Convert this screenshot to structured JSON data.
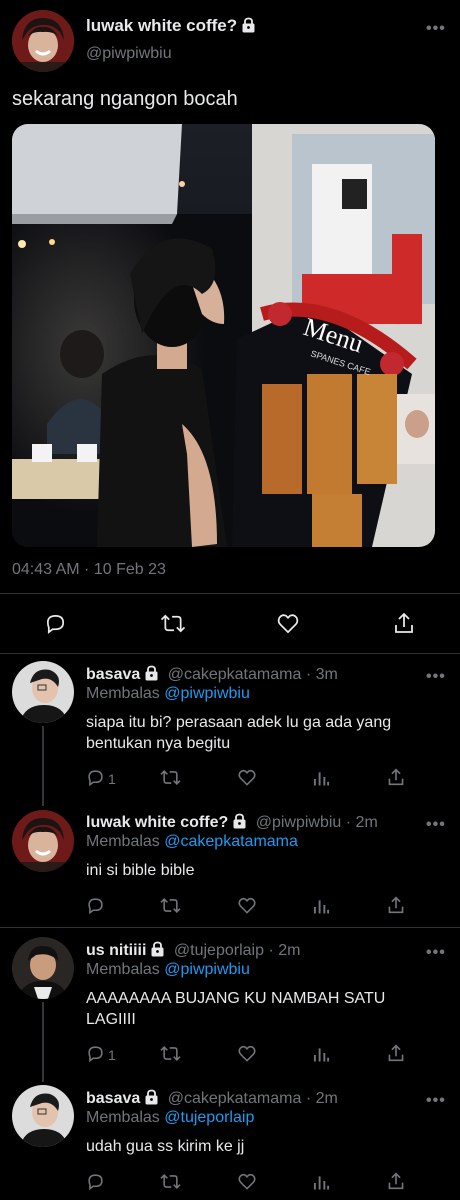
{
  "main_tweet": {
    "name": "luwak white coffe?",
    "handle": "@piwpiwbiu",
    "text": "sekarang ngangon bocah",
    "media_sign": "Menu",
    "media_subsign": "SPANES CAFE",
    "timestamp": "04:43 AM · 10 Feb 23"
  },
  "more_label": "•••",
  "replies": [
    {
      "name": "basava",
      "handle": "@cakepkatamama",
      "time": "· 3m",
      "replying_prefix": "Membalas",
      "replying_to": "@piwpiwbiu",
      "text": "siapa itu bi? perasaan adek lu ga ada yang bentukan nya begitu",
      "reply_count": "1"
    },
    {
      "name": "luwak white coffe?",
      "handle": "@piwpiwbiu",
      "time": "· 2m",
      "replying_prefix": "Membalas",
      "replying_to": "@cakepkatamama",
      "text": "ini si bible bible",
      "reply_count": ""
    },
    {
      "name": "us nitiiii",
      "handle": "@tujeporlaip",
      "time": "· 2m",
      "replying_prefix": "Membalas",
      "replying_to": "@piwpiwbiu",
      "text": "AAAAAAAA BUJANG KU NAMBAH SATU LAGIIII",
      "reply_count": "1"
    },
    {
      "name": "basava",
      "handle": "@cakepkatamama",
      "time": "· 2m",
      "replying_prefix": "Membalas",
      "replying_to": "@tujeporlaip",
      "text": "udah gua ss kirim ke jj",
      "reply_count": ""
    }
  ],
  "colors": {
    "background": "#000000",
    "text": "#e7e9ea",
    "muted": "#71767b",
    "link": "#1d9bf0",
    "divider": "#2f3336"
  },
  "icons": [
    "lock-icon",
    "more-icon",
    "reply-icon",
    "retweet-icon",
    "like-icon",
    "share-icon",
    "views-icon"
  ]
}
